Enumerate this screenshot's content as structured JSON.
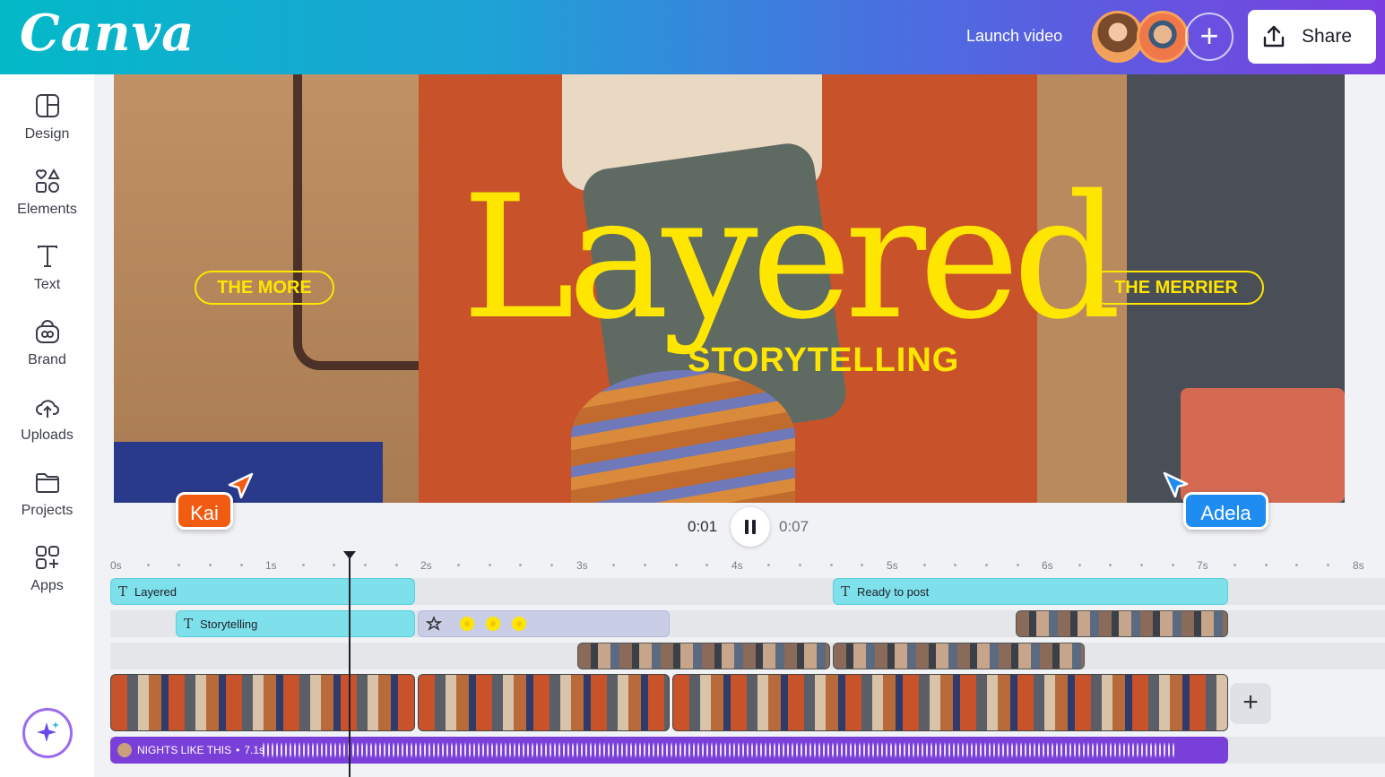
{
  "header": {
    "logo_text": "Canva",
    "launch_label": "Launch video",
    "share_label": "Share",
    "add_collaborator_symbol": "+"
  },
  "sidebar": {
    "items": [
      {
        "label": "Design",
        "icon": "layout-icon"
      },
      {
        "label": "Elements",
        "icon": "shapes-icon"
      },
      {
        "label": "Text",
        "icon": "text-icon"
      },
      {
        "label": "Brand",
        "icon": "brand-icon"
      },
      {
        "label": "Uploads",
        "icon": "cloud-upload-icon"
      },
      {
        "label": "Projects",
        "icon": "folder-icon"
      },
      {
        "label": "Apps",
        "icon": "apps-icon"
      }
    ]
  },
  "canvas": {
    "title": "Layered",
    "subtitle": "STORYTELLING",
    "pill_left": "THE MORE",
    "pill_right": "THE MERRIER"
  },
  "collaborators": {
    "left_name": "Kai",
    "left_color": "#f25c12",
    "right_name": "Adela",
    "right_color": "#1e8cf0"
  },
  "playback": {
    "current_time": "0:01",
    "total_time": "0:07"
  },
  "timeline": {
    "ruler": [
      "0s",
      "1s",
      "2s",
      "3s",
      "4s",
      "5s",
      "6s",
      "7s",
      "8s"
    ],
    "text_clips": {
      "layered": "Layered",
      "storytelling": "Storytelling",
      "ready": "Ready to post"
    },
    "audio": {
      "title": "NIGHTS LIKE THIS",
      "duration": "7.1s"
    },
    "add_symbol": "+"
  },
  "colors": {
    "accent_yellow": "#ffe600",
    "text_clip": "#7ee0ea",
    "audio_clip": "#7a3fd8"
  }
}
